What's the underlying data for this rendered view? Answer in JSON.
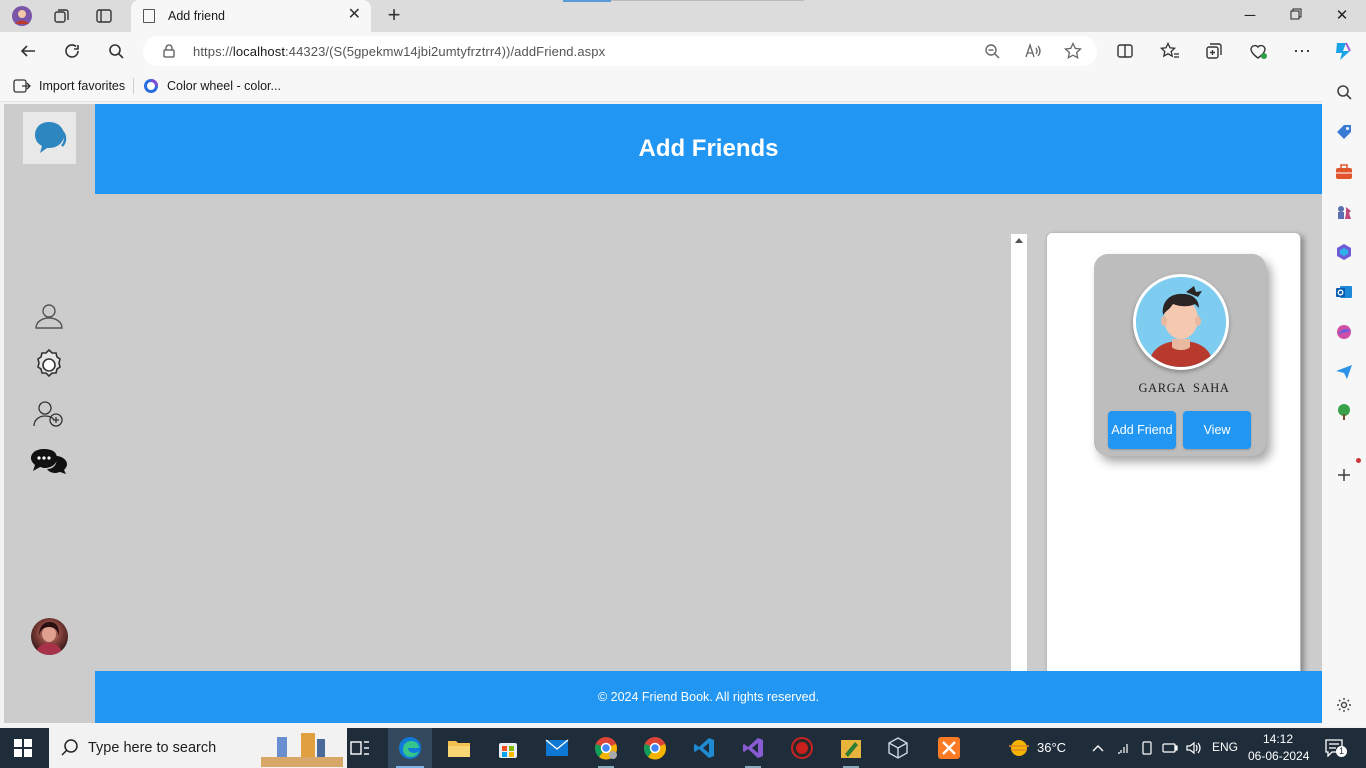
{
  "browser": {
    "tab_title": "Add friend",
    "url_prefix": "https://",
    "url_host": "localhost",
    "url_rest": ":44323/(S(5gpekmw14jbi2umtyfrztrr4))/addFriend.aspx",
    "favorites": [
      {
        "label": "Import favorites",
        "icon": "import-favorites-icon"
      },
      {
        "label": "Color wheel - color...",
        "icon": "color-wheel-favicon"
      }
    ]
  },
  "page": {
    "header_title": "Add Friends",
    "nav_items": [
      {
        "name": "profile-icon"
      },
      {
        "name": "settings-icon"
      },
      {
        "name": "add-friend-icon"
      },
      {
        "name": "chat-icon"
      }
    ],
    "friend_card": {
      "name": "GARGA  SAHA",
      "add_button": "Add Friend",
      "view_button": "View"
    },
    "footer_text": "© 2024 Friend Book. All rights reserved."
  },
  "taskbar": {
    "search_placeholder": "Type here to search",
    "weather": "36°C",
    "language": "ENG",
    "time": "14:12",
    "date": "06-06-2024",
    "notification_count": "1"
  },
  "colors": {
    "primary": "#2196f3",
    "page_background": "#cccccc",
    "card_background": "#bdbdbd"
  }
}
